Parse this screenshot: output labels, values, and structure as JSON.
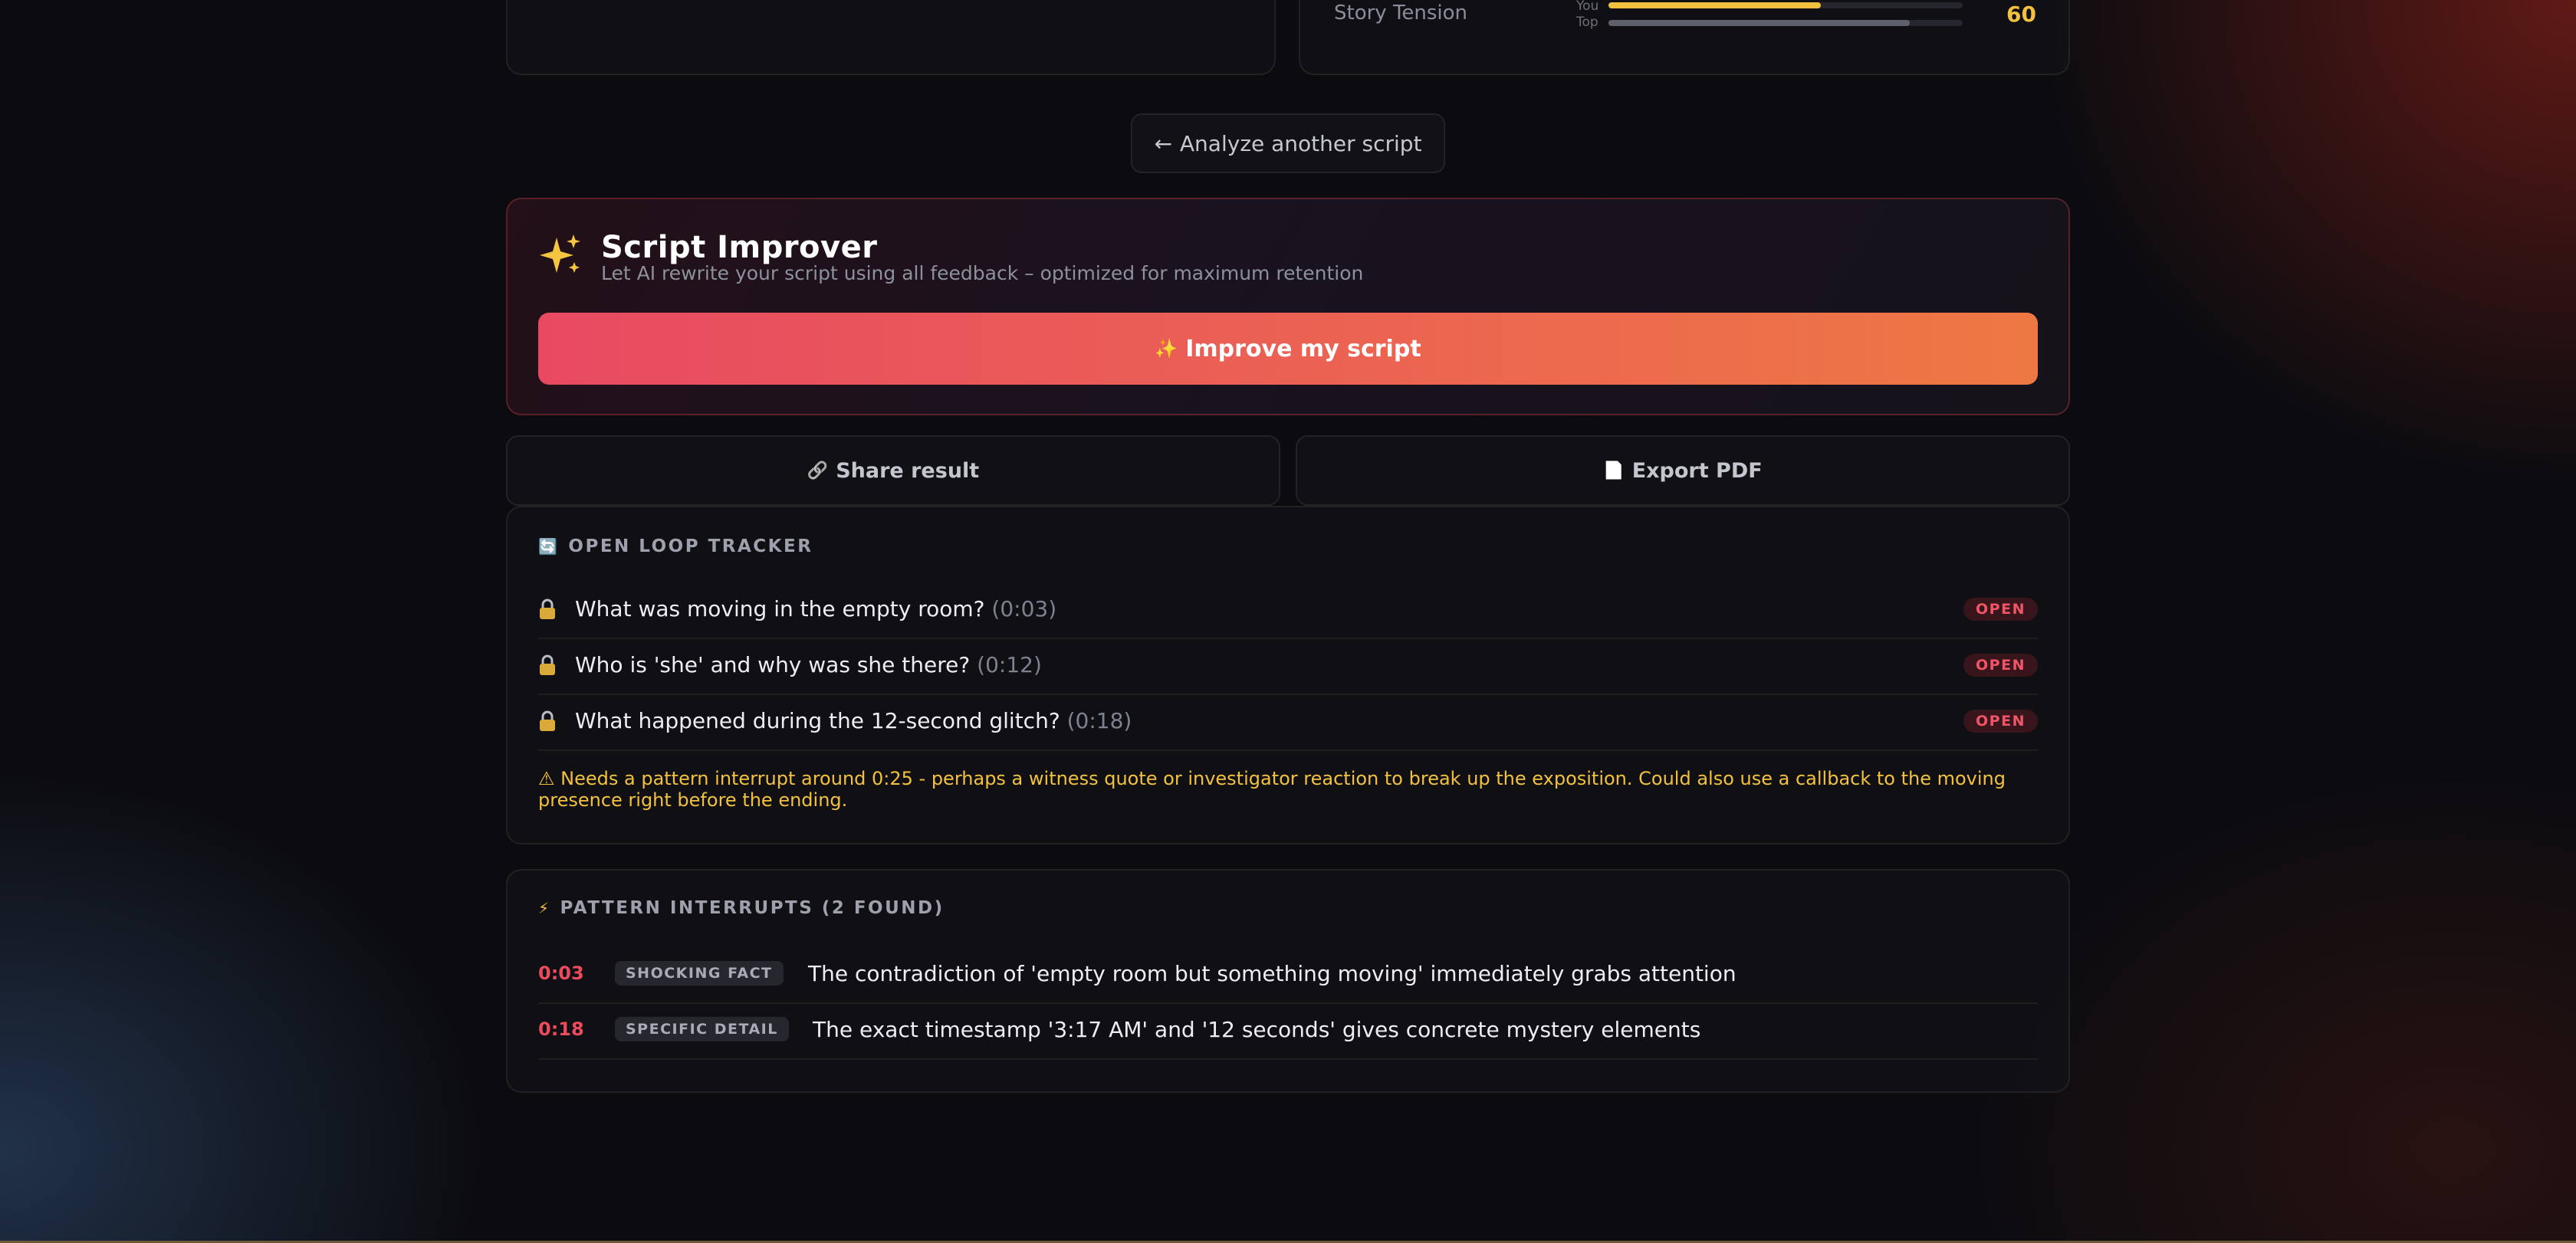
{
  "top_card": {
    "metric_label": "Story Tension",
    "you_label": "You",
    "top_label": "Top",
    "you_value": 60,
    "top_value": 85,
    "score": "60"
  },
  "analyze_button": {
    "arrow": "←",
    "label": "Analyze another script"
  },
  "improver": {
    "icon": "sparkles-icon",
    "title": "Script Improver",
    "subtitle": "Let AI rewrite your script using all feedback – optimized for maximum retention",
    "button_icon": "✨",
    "button_label": "Improve my script"
  },
  "share": {
    "icon": "🔗",
    "label": "Share result"
  },
  "export": {
    "icon": "📄",
    "label": "Export PDF"
  },
  "open_loops": {
    "header_icon": "🔄",
    "header": "OPEN LOOP TRACKER",
    "items": [
      {
        "question": "What was moving in the empty room?",
        "time": "(0:03)",
        "status": "OPEN"
      },
      {
        "question": "Who is 'she' and why was she there?",
        "time": "(0:12)",
        "status": "OPEN"
      },
      {
        "question": "What happened during the 12-second glitch?",
        "time": "(0:18)",
        "status": "OPEN"
      }
    ],
    "warning": "⚠ Needs a pattern interrupt around 0:25 - perhaps a witness quote or investigator reaction to break up the exposition. Could also use a callback to the moving presence right before the ending."
  },
  "pattern_interrupts": {
    "header_icon": "⚡",
    "header": "PATTERN INTERRUPTS (2 FOUND)",
    "items": [
      {
        "time": "0:03",
        "tag": "SHOCKING FACT",
        "text": "The contradiction of 'empty room but something moving' immediately grabs attention"
      },
      {
        "time": "0:18",
        "tag": "SPECIFIC DETAIL",
        "text": "The exact timestamp '3:17 AM' and '12 seconds' gives concrete mystery elements"
      }
    ]
  },
  "colors": {
    "accent_red": "#ec4a5d",
    "accent_orange": "#ee7844",
    "warning_yellow": "#f2c13d"
  }
}
